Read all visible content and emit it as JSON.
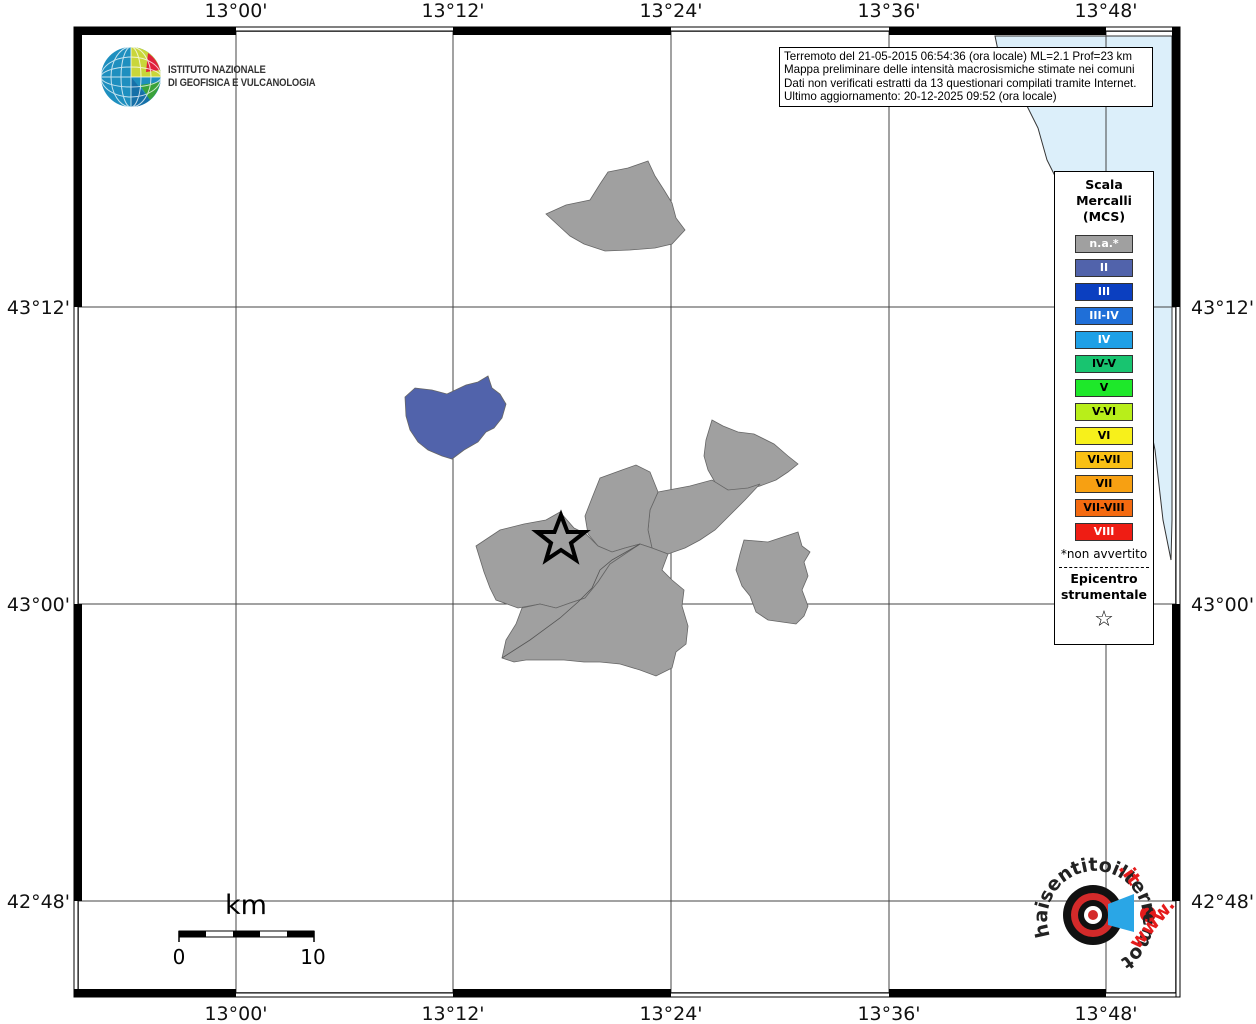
{
  "map": {
    "lon_ticks_top": [
      "13°00'",
      "13°12'",
      "13°24'",
      "13°36'",
      "13°48'"
    ],
    "lon_ticks_bottom": [
      "13°00'",
      "13°12'",
      "13°24'",
      "13°36'",
      "13°48'"
    ],
    "lat_ticks_left": [
      "43°12'",
      "43°00'",
      "42°48'"
    ],
    "lat_ticks_right": [
      "43°12'",
      "43°00'",
      "42°48'"
    ],
    "water_color": "#dceffa",
    "na_color": "#a0a0a0",
    "intensity_II_color": "#5163ab"
  },
  "logo": {
    "institute_line1": "ISTITUTO NAZIONALE",
    "institute_line2": "DI GEOFISICA E VULCANOLOGIA"
  },
  "info": {
    "line1": "Terremoto del 21-05-2015 06:54:36 (ora locale) ML=2.1 Prof=23 km",
    "line2": "Mappa preliminare delle intensità macrosismiche stimate nei comuni",
    "line3": "Dati non verificati estratti da 13 questionari compilati tramite Internet.",
    "line4": "Ultimo aggiornamento: 20-12-2025 09:52 (ora locale)"
  },
  "legend": {
    "title_line1": "Scala",
    "title_line2": "Mercalli",
    "title_line3": "(MCS)",
    "items": [
      {
        "label": "n.a.*",
        "color": "#a0a0a0",
        "text_color": "#ffffff"
      },
      {
        "label": "II",
        "color": "#5163ab",
        "text_color": "#ffffff"
      },
      {
        "label": "III",
        "color": "#0b3fc0",
        "text_color": "#ffffff"
      },
      {
        "label": "III-IV",
        "color": "#1f6fd8",
        "text_color": "#ffffff"
      },
      {
        "label": "IV",
        "color": "#1ea0e6",
        "text_color": "#ffffff"
      },
      {
        "label": "IV-V",
        "color": "#18c470",
        "text_color": "#000000"
      },
      {
        "label": "V",
        "color": "#1ee82a",
        "text_color": "#000000"
      },
      {
        "label": "V-VI",
        "color": "#b8ee1a",
        "text_color": "#000000"
      },
      {
        "label": "VI",
        "color": "#f7f01b",
        "text_color": "#000000"
      },
      {
        "label": "VI-VII",
        "color": "#f9c014",
        "text_color": "#000000"
      },
      {
        "label": "VII",
        "color": "#f7a012",
        "text_color": "#000000"
      },
      {
        "label": "VII-VIII",
        "color": "#f46a10",
        "text_color": "#000000"
      },
      {
        "label": "VIII",
        "color": "#ef1d14",
        "text_color": "#ffffff"
      }
    ],
    "note": "*non avvertito",
    "epi_line1": "Epicentro",
    "epi_line2": "strumentale",
    "epi_symbol": "☆"
  },
  "scalebar": {
    "unit": "km",
    "start": "0",
    "end": "10"
  },
  "haisentito": {
    "text_main": "haisentitoilterremoto",
    "text_tld": ".it",
    "text_www": "www.",
    "question": "?"
  }
}
